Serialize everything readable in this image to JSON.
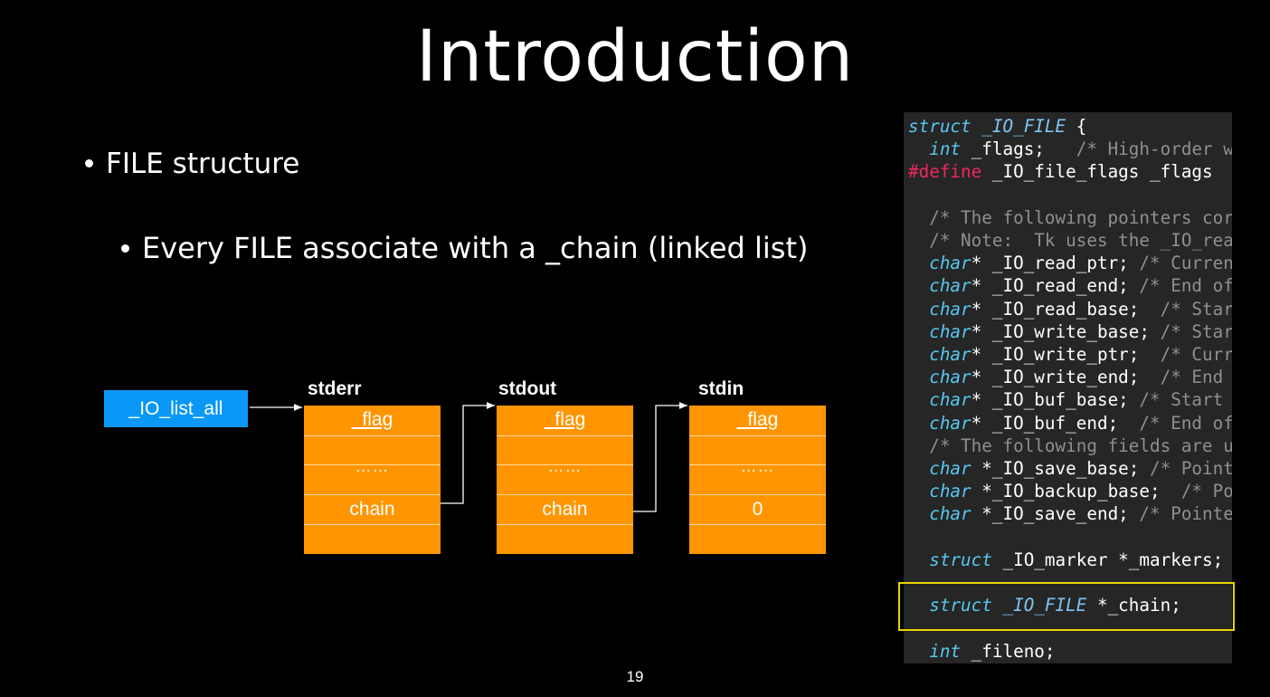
{
  "slide": {
    "title": "Introduction",
    "bullets": [
      "FILE structure",
      "Every FILE associate with a _chain (linked list)"
    ],
    "page_number": "19"
  },
  "diagram": {
    "head_label": "_IO_list_all",
    "nodes": [
      {
        "name": "stderr",
        "flag": "_flag",
        "dots": "……",
        "link": "chain"
      },
      {
        "name": "stdout",
        "flag": "_flag",
        "dots": "……",
        "link": "chain"
      },
      {
        "name": "stdin",
        "flag": "_flag",
        "dots": "……",
        "link": "0"
      }
    ],
    "colors": {
      "node": "#ff9500",
      "head": "#0a98f7",
      "highlight": "#e8d400"
    }
  },
  "code": {
    "lines": [
      [
        {
          "t": "struct",
          "c": "kw"
        },
        {
          "t": " _IO_FILE ",
          "c": "ty"
        },
        {
          "t": "{",
          "c": ""
        }
      ],
      [
        {
          "t": "  ",
          "c": ""
        },
        {
          "t": "int",
          "c": "kw"
        },
        {
          "t": " _flags;   ",
          "c": ""
        },
        {
          "t": "/* High-order w",
          "c": "cm"
        }
      ],
      [
        {
          "t": "#define",
          "c": "def"
        },
        {
          "t": " _IO_file_flags _flags",
          "c": ""
        }
      ],
      [
        {
          "t": "",
          "c": ""
        }
      ],
      [
        {
          "t": "  /* The following pointers cor",
          "c": "cm"
        }
      ],
      [
        {
          "t": "  /* Note:  Tk uses the _IO_rea",
          "c": "cm"
        }
      ],
      [
        {
          "t": "  ",
          "c": ""
        },
        {
          "t": "char",
          "c": "kw"
        },
        {
          "t": "* _IO_read_ptr; ",
          "c": ""
        },
        {
          "t": "/* Curren",
          "c": "cm"
        }
      ],
      [
        {
          "t": "  ",
          "c": ""
        },
        {
          "t": "char",
          "c": "kw"
        },
        {
          "t": "* _IO_read_end; ",
          "c": ""
        },
        {
          "t": "/* End of",
          "c": "cm"
        }
      ],
      [
        {
          "t": "  ",
          "c": ""
        },
        {
          "t": "char",
          "c": "kw"
        },
        {
          "t": "* _IO_read_base;  ",
          "c": ""
        },
        {
          "t": "/* Star",
          "c": "cm"
        }
      ],
      [
        {
          "t": "  ",
          "c": ""
        },
        {
          "t": "char",
          "c": "kw"
        },
        {
          "t": "* _IO_write_base; ",
          "c": ""
        },
        {
          "t": "/* Star",
          "c": "cm"
        }
      ],
      [
        {
          "t": "  ",
          "c": ""
        },
        {
          "t": "char",
          "c": "kw"
        },
        {
          "t": "* _IO_write_ptr;  ",
          "c": ""
        },
        {
          "t": "/* Curr",
          "c": "cm"
        }
      ],
      [
        {
          "t": "  ",
          "c": ""
        },
        {
          "t": "char",
          "c": "kw"
        },
        {
          "t": "* _IO_write_end;  ",
          "c": ""
        },
        {
          "t": "/* End",
          "c": "cm"
        }
      ],
      [
        {
          "t": "  ",
          "c": ""
        },
        {
          "t": "char",
          "c": "kw"
        },
        {
          "t": "* _IO_buf_base; ",
          "c": ""
        },
        {
          "t": "/* Start",
          "c": "cm"
        }
      ],
      [
        {
          "t": "  ",
          "c": ""
        },
        {
          "t": "char",
          "c": "kw"
        },
        {
          "t": "* _IO_buf_end;  ",
          "c": ""
        },
        {
          "t": "/* End of",
          "c": "cm"
        }
      ],
      [
        {
          "t": "  /* The following fields are u",
          "c": "cm"
        }
      ],
      [
        {
          "t": "  ",
          "c": ""
        },
        {
          "t": "char",
          "c": "kw"
        },
        {
          "t": " *_IO_save_base; ",
          "c": ""
        },
        {
          "t": "/* Point",
          "c": "cm"
        }
      ],
      [
        {
          "t": "  ",
          "c": ""
        },
        {
          "t": "char",
          "c": "kw"
        },
        {
          "t": " *_IO_backup_base;  ",
          "c": ""
        },
        {
          "t": "/* Po",
          "c": "cm"
        }
      ],
      [
        {
          "t": "  ",
          "c": ""
        },
        {
          "t": "char",
          "c": "kw"
        },
        {
          "t": " *_IO_save_end; ",
          "c": ""
        },
        {
          "t": "/* Pointe",
          "c": "cm"
        }
      ],
      [
        {
          "t": "",
          "c": ""
        }
      ],
      [
        {
          "t": "  ",
          "c": ""
        },
        {
          "t": "struct",
          "c": "kw"
        },
        {
          "t": " _IO_marker *_markers;",
          "c": ""
        }
      ],
      [
        {
          "t": "",
          "c": ""
        }
      ],
      [
        {
          "t": "  ",
          "c": ""
        },
        {
          "t": "struct",
          "c": "kw"
        },
        {
          "t": " _IO_FILE ",
          "c": "ty"
        },
        {
          "t": "*_chain;",
          "c": ""
        }
      ],
      [
        {
          "t": "",
          "c": ""
        }
      ],
      [
        {
          "t": "  ",
          "c": ""
        },
        {
          "t": "int",
          "c": "kw"
        },
        {
          "t": " _fileno;",
          "c": ""
        }
      ]
    ]
  }
}
